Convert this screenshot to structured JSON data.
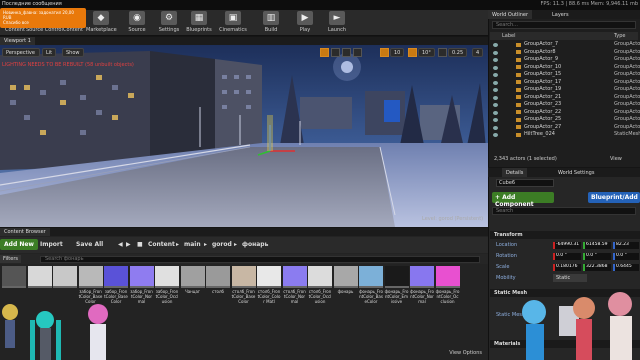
{
  "titlebar": {
    "text": "Последние сообщения"
  },
  "notice": {
    "line1": "Новинка_фавна: задонатил 20,00 RUB",
    "line2": "Спасибо все"
  },
  "fps": {
    "text": "FPS: 11.3 | 88.6 ms  Mem: 9,946.11 mb"
  },
  "toolbar": {
    "buttons": [
      {
        "label": "Content",
        "icon": "save-icon"
      },
      {
        "label": "Source Control",
        "icon": "source-control-icon"
      },
      {
        "label": "Content",
        "icon": "content-icon"
      },
      {
        "label": "Marketplace",
        "icon": "marketplace-icon"
      },
      {
        "label": "Source",
        "icon": "source-icon"
      },
      {
        "label": "Settings",
        "icon": "settings-icon"
      },
      {
        "label": "Blueprints",
        "icon": "blueprints-icon"
      },
      {
        "label": "Cinematics",
        "icon": "cinematics-icon"
      },
      {
        "label": "Build",
        "icon": "build-icon"
      },
      {
        "label": "Play",
        "icon": "play-icon"
      },
      {
        "label": "Launch",
        "icon": "launch-icon"
      }
    ]
  },
  "viewport": {
    "tab": "Viewport 1",
    "perspective": "Perspective",
    "lit": "Lit",
    "show": "Show",
    "warning": "LIGHTING NEEDS TO BE REBUILT (58 unbuilt objects)",
    "credit": "Level: gorod (Persistent)",
    "snap_values": [
      "10",
      "10°",
      "0.25",
      "4"
    ]
  },
  "content_browser": {
    "tab": "Content Browser",
    "add_new": "Add New",
    "import": "Import",
    "save_all": "Save All",
    "path": [
      "Content",
      "main",
      "gorod",
      "фонарь"
    ],
    "filters": "Filters",
    "search_placeholder": "Search фонарь",
    "assets": [
      {
        "name": "",
        "color": "#555555"
      },
      {
        "name": "",
        "color": "#d8d8d8"
      },
      {
        "name": "",
        "color": "#c8c8c8"
      },
      {
        "name": "забор_FrontColor_BaseColor",
        "color": "#b9b9b9"
      },
      {
        "name": "забор_FrontColor_BaseColor",
        "color": "#5a52d8"
      },
      {
        "name": "забор_FrontColor_Normal",
        "color": "#8f7cf0"
      },
      {
        "name": "забор_FrontColor_Occlusion",
        "color": "#e0e0e0"
      },
      {
        "name": "Чанцаг",
        "color": "#a0a0a0"
      },
      {
        "name": "столб",
        "color": "#9a9a9a"
      },
      {
        "name": "столб_FrontColor_Base Color",
        "color": "#c8b7a4"
      },
      {
        "name": "столб_FrontColor_Color Matl",
        "color": "#e8e8e8"
      },
      {
        "name": "столб_FrontColor_Normal",
        "color": "#8b7cf0"
      },
      {
        "name": "столб_FrontColor_Occlusion",
        "color": "#dcdcdc"
      },
      {
        "name": "фонарь",
        "color": "#a8a8a8"
      },
      {
        "name": "фонарь_FrontColor_BaseColor",
        "color": "#7cb0d8"
      },
      {
        "name": "фонарь_FrontColor_Emissive",
        "color": "#1a1a1a"
      },
      {
        "name": "фонарь_FrontColor_Normal",
        "color": "#8877ef"
      },
      {
        "name": "фонарь_FrontColor_Occlusion",
        "color": "#e850d0"
      }
    ],
    "view_options": "View Options"
  },
  "world_outliner": {
    "tabs": [
      "World Outliner",
      "Layers"
    ],
    "search_placeholder": "Search...",
    "col_label": "Label",
    "col_type": "Type",
    "rows": [
      {
        "name": "GroupActor_7",
        "type": "GroupActor"
      },
      {
        "name": "GroupActor8",
        "type": "GroupActor"
      },
      {
        "name": "GroupActor_9",
        "type": "GroupActor"
      },
      {
        "name": "GroupActor_10",
        "type": "GroupActor"
      },
      {
        "name": "GroupActor_15",
        "type": "GroupActor"
      },
      {
        "name": "GroupActor_17",
        "type": "GroupActor"
      },
      {
        "name": "GroupActor_19",
        "type": "GroupActor"
      },
      {
        "name": "GroupActor_21",
        "type": "GroupActor"
      },
      {
        "name": "GroupActor_23",
        "type": "GroupActor"
      },
      {
        "name": "GroupActor_22",
        "type": "GroupActor"
      },
      {
        "name": "GroupActor_25",
        "type": "GroupActor"
      },
      {
        "name": "GroupActor_27",
        "type": "GroupActor"
      },
      {
        "name": "HiltTree_024",
        "type": "StaticMesh"
      }
    ],
    "count": "2,343 actors (1 selected)",
    "view_options": "View"
  },
  "details": {
    "tabs": [
      "Details",
      "World Settings"
    ],
    "actor_name": "Cube6",
    "add_component": "+ Add Component",
    "blueprint": "Blueprint/Add",
    "search_placeholder": "Search",
    "transform": "Transform",
    "location": {
      "label": "Location",
      "x": "-64990.31",
      "y": "61458.59",
      "z": "82.23"
    },
    "rotation": {
      "label": "Rotation",
      "x": "0.0 °",
      "y": "0.0 °",
      "z": "0.0 °"
    },
    "scale": {
      "label": "Scale",
      "x": "0.180176",
      "y": "322.3868",
      "z": "0.6445"
    },
    "mobility": {
      "label": "Mobility",
      "value": "Static"
    },
    "static_mesh_section": "Static Mesh",
    "static_mesh_prop": "Static Mesh",
    "materials_section": "Materials"
  }
}
